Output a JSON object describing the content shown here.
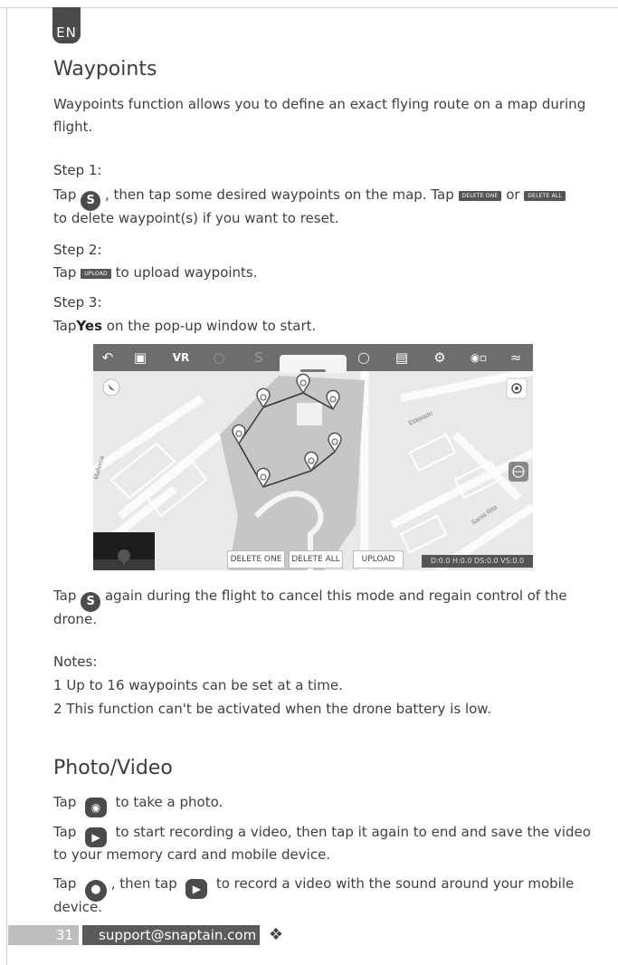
{
  "lang_tab": "EN",
  "waypoints": {
    "title": "Waypoints",
    "intro_line1": "Waypoints function allows you to define an exact flying route on a map during",
    "intro_line2": "flight.",
    "step1_label": "Step 1:",
    "step1_a": "Tap",
    "step1_b": ", then tap some desired waypoints on the map. Tap",
    "step1_or": "or",
    "step1_line2": "to delete waypoint(s) if you want to reset.",
    "delete_one_label": "DELETE ONE",
    "delete_all_label": "DELETE ALL",
    "step2_label": "Step 2:",
    "step2_a": "Tap",
    "step2_b": "to upload waypoints.",
    "upload_label": "UPLOAD",
    "step3_label": "Step 3:",
    "step3_a": "Tap",
    "step3_yes": "Yes",
    "step3_b": "on the pop-up window to start.",
    "cancel_a": "Tap",
    "cancel_b": "again during the flight to cancel this mode and regain control of the",
    "cancel_line2": "drone."
  },
  "screenshot": {
    "toolbar_vr": "VR",
    "map_delete_one": "DELETE ONE",
    "map_delete_all": "DELETE ALL",
    "map_upload": "UPLOAD",
    "status": "D:0.0 H:0.0 DS:0.0 VS:0.0",
    "street1": "Eldorado",
    "street2": "Mallorca",
    "street3": "Santa Rita",
    "waypoint_markers": [
      "1",
      "2",
      "3",
      "4",
      "5",
      "6",
      "7"
    ]
  },
  "notes": {
    "title": "Notes:",
    "items": [
      {
        "num": "1",
        "text": "Up to 16 waypoints can be set at a time."
      },
      {
        "num": "2",
        "text": "This function can't be activated when the drone battery is low."
      }
    ]
  },
  "photo_video": {
    "title": "Photo/Video",
    "photo_a": "Tap",
    "photo_b": "to take a photo.",
    "video_a": "Tap",
    "video_b": "to start recording a video, then tap it again to end and save the video",
    "video_line2": "to your memory card and mobile device.",
    "sound_a": "Tap",
    "sound_b": ", then tap",
    "sound_c": "to record a video with the sound around your mobile",
    "sound_line2": "device."
  },
  "footer": {
    "page_number": "31",
    "email": "support@snaptain.com"
  },
  "icons": {
    "waypoint_mode": "route-s-icon",
    "camera": "camera-icon",
    "video": "video-icon",
    "microphone": "microphone-icon",
    "logo": "drone-logo-icon"
  }
}
